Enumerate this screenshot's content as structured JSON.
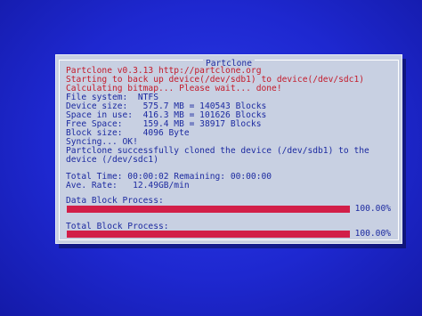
{
  "dialog": {
    "title": "Partclone",
    "lines": [
      "Partclone v0.3.13 http://partclone.org",
      "Starting to back up device(/dev/sdb1) to device(/dev/sdc1)",
      "Calculating bitmap... Please wait... done!",
      "File system:  NTFS",
      "Device size:   575.7 MB = 140543 Blocks",
      "Space in use:  416.3 MB = 101626 Blocks",
      "Free Space:    159.4 MB = 38917 Blocks",
      "Block size:    4096 Byte",
      "Syncing... OK!",
      "Partclone successfully cloned the device (/dev/sdb1) to the",
      "device (/dev/sdc1)"
    ],
    "total_time_line": "Total Time: 00:00:02 Remaining: 00:00:00",
    "rate_line": "Ave. Rate:   12.49GB/min",
    "data_block": {
      "label": "Data Block Process:",
      "percent_text": "100.00%",
      "fraction": 1.0
    },
    "total_block": {
      "label": "Total Block Process:",
      "percent_text": "100.00%",
      "fraction": 1.0
    }
  },
  "colors": {
    "background": "#1a22c8",
    "dialog": "#c8d0e2",
    "text_red": "#c41a2a",
    "text_blue": "#1c2aa0",
    "progress": "#d21e48"
  }
}
